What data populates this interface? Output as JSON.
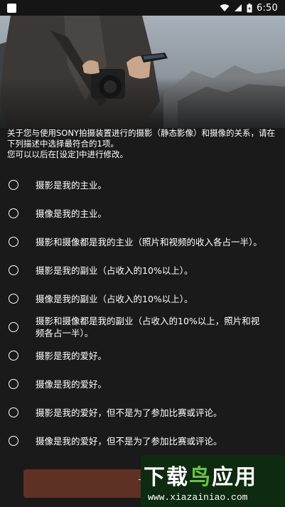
{
  "status_bar": {
    "time": "6:50"
  },
  "intro": {
    "line1": "关于您与使用SONY拍摄装置进行的摄影（静态影像）和摄像的关系，请在下列描述中选择最符合的1项。",
    "line2": "您可以以后在[设定]中进行修改。"
  },
  "options": [
    {
      "label": "摄影是我的主业。"
    },
    {
      "label": "摄像是我的主业。"
    },
    {
      "label": "摄影和摄像都是我的主业（照片和视频的收入各占一半）。"
    },
    {
      "label": "摄影是我的副业（占收入的10%以上）。"
    },
    {
      "label": "摄像是我的副业（占收入的10%以上）。"
    },
    {
      "label": "摄影和摄像都是我的副业（占收入的10%以上，照片和视频各占一半）。"
    },
    {
      "label": "摄影是我的爱好。"
    },
    {
      "label": "摄像是我的爱好。"
    },
    {
      "label": "摄影是我的爱好，但不是为了参加比赛或评论。"
    },
    {
      "label": "摄像是我的爱好，但不是为了参加比赛或评论。"
    }
  ],
  "confirm_button": {
    "label": "下"
  },
  "watermark": {
    "brand_part1": "下载",
    "brand_part2": "鸟",
    "brand_part3": "应用",
    "url": "www.xiazainiao.com"
  },
  "colors": {
    "background": "#1a1a1a",
    "button": "#5f3024",
    "watermark_bg": "#0e2a10",
    "watermark_accent": "#6cc04a"
  }
}
